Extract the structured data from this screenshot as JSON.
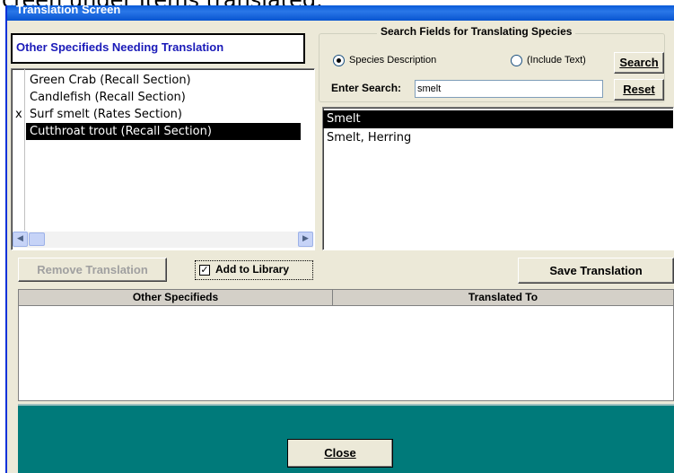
{
  "caption": "creen under Items translated.",
  "window": {
    "title": "Translation Screen"
  },
  "left_panel": {
    "header": "Other Specifieds Needing Translation",
    "items": [
      {
        "mark": "",
        "label": "Green Crab  (Recall Section)",
        "selected": false
      },
      {
        "mark": "",
        "label": "Candlefish  (Recall Section)",
        "selected": false
      },
      {
        "mark": "x",
        "label": "Surf smelt  (Rates Section)",
        "selected": false
      },
      {
        "mark": "",
        "label": "Cutthroat trout  (Recall Section)",
        "selected": true
      }
    ]
  },
  "search": {
    "legend": "Search Fields for Translating Species",
    "radio_species": "Species Description",
    "radio_include": "(Include Text)",
    "search_button": "Search",
    "reset_button": "Reset",
    "enter_label": "Enter Search:",
    "value": "smelt"
  },
  "results": {
    "items": [
      {
        "label": "Smelt",
        "selected": true
      },
      {
        "label": "Smelt, Herring",
        "selected": false
      }
    ]
  },
  "actions": {
    "remove_translation": "Remove Translation",
    "add_to_library": "Add to Library",
    "add_to_library_checked": true,
    "save_translation": "Save Translation"
  },
  "table": {
    "columns": [
      "Other Specifieds",
      "Translated To"
    ]
  },
  "footer": {
    "close": "Close"
  },
  "colors": {
    "title_bar": "#0a5bd9",
    "footer": "#007a7a",
    "selection": "#000000",
    "header_text": "#1a1ab8"
  }
}
